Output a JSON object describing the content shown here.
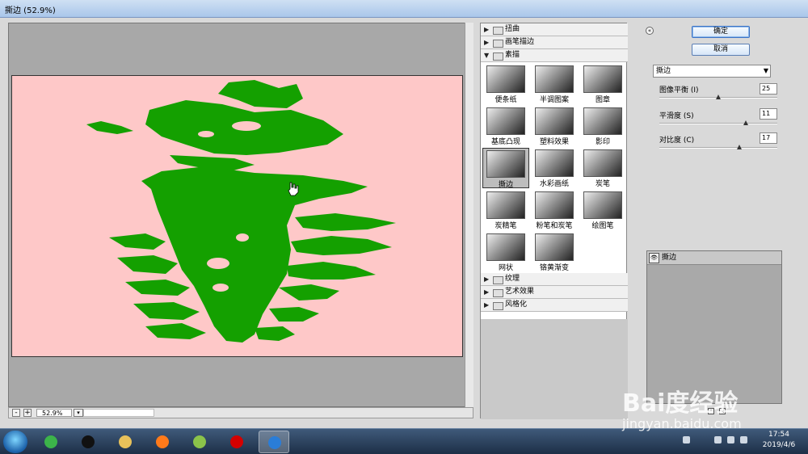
{
  "window": {
    "title": "撕边 (52.9%)"
  },
  "preview": {
    "canvas_bg": "#fec8c8",
    "shape_color": "#14a000",
    "zoom_minus": "-",
    "zoom_plus": "+",
    "zoom_value": "52.9%",
    "zoom_dropdown": "▾"
  },
  "gallery": {
    "categories_top": [
      {
        "label": "扭曲",
        "arrow": "▶"
      },
      {
        "label": "画笔描边",
        "arrow": "▶"
      },
      {
        "label": "素描",
        "arrow": "▼"
      }
    ],
    "thumbs": [
      {
        "label": "便条纸"
      },
      {
        "label": "半调图案"
      },
      {
        "label": "图章"
      },
      {
        "label": "基底凸现"
      },
      {
        "label": "塑料效果"
      },
      {
        "label": "影印"
      },
      {
        "label": "撕边"
      },
      {
        "label": "水彩画纸"
      },
      {
        "label": "炭笔"
      },
      {
        "label": "炭精笔"
      },
      {
        "label": "粉笔和炭笔"
      },
      {
        "label": "绘图笔"
      },
      {
        "label": "网状"
      },
      {
        "label": "铬黄渐变"
      }
    ],
    "categories_bottom": [
      {
        "label": "纹理",
        "arrow": "▶"
      },
      {
        "label": "艺术效果",
        "arrow": "▶"
      },
      {
        "label": "风格化",
        "arrow": "▶"
      }
    ]
  },
  "controls": {
    "collapse": "«",
    "ok_label": "确定",
    "cancel_label": "取消",
    "filter_select": "撕边",
    "params": [
      {
        "label": "图像平衡 (I)",
        "value": "25",
        "fraction": 0.5
      },
      {
        "label": "平滑度 (S)",
        "value": "11",
        "fraction": 0.73
      },
      {
        "label": "对比度 (C)",
        "value": "17",
        "fraction": 0.68
      }
    ],
    "layer_name": "撕边"
  },
  "taskbar": {
    "time": "17:54",
    "date": "2019/4/6",
    "apps": [
      {
        "icon": "browser-icon",
        "color": "#3cb44a"
      },
      {
        "icon": "qq-icon",
        "color": "#111111"
      },
      {
        "icon": "folder-icon",
        "color": "#e8c15a"
      },
      {
        "icon": "firefox-icon",
        "color": "#ff7a1a"
      },
      {
        "icon": "media-icon",
        "color": "#8bc34a"
      },
      {
        "icon": "record-icon",
        "color": "#d40000"
      },
      {
        "icon": "feather-icon",
        "color": "#2a7dd8"
      }
    ]
  },
  "watermark": {
    "line1": "Bai度经验",
    "line2": "jingyan.baidu.com"
  }
}
